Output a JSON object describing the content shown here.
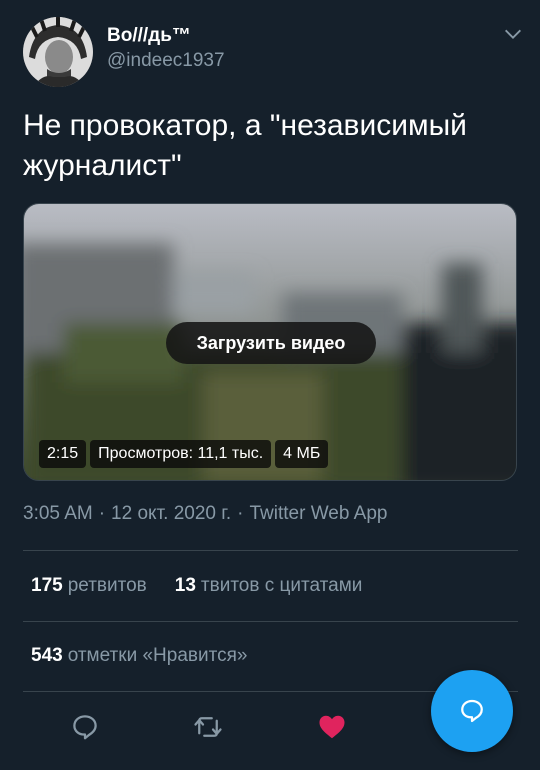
{
  "user": {
    "display_name": "Во///дь™",
    "handle": "@indeec1937"
  },
  "tweet": {
    "text": "Не провокатор, а \"независимый журналист\""
  },
  "media": {
    "load_label": "Загрузить видео",
    "duration": "2:15",
    "views": "Просмотров: 11,1 тыс.",
    "size": "4 МБ"
  },
  "meta": {
    "time": "3:05 AM",
    "sep1": "·",
    "date": "12 окт. 2020 г.",
    "sep2": "·",
    "source": "Twitter Web App"
  },
  "stats": {
    "retweets_count": "175",
    "retweets_label": "ретвитов",
    "quotes_count": "13",
    "quotes_label": "твитов с цитатами",
    "likes_count": "543",
    "likes_label": "отметки «Нравится»"
  },
  "icons": {
    "reply": "reply-icon",
    "retweet": "retweet-icon",
    "like": "heart-icon",
    "compose": "compose-icon",
    "menu": "chevron-down-icon"
  },
  "colors": {
    "background": "#15202b",
    "accent": "#1da1f2",
    "like": "#e0245e",
    "muted": "#8899a6",
    "divider": "#38444d"
  }
}
